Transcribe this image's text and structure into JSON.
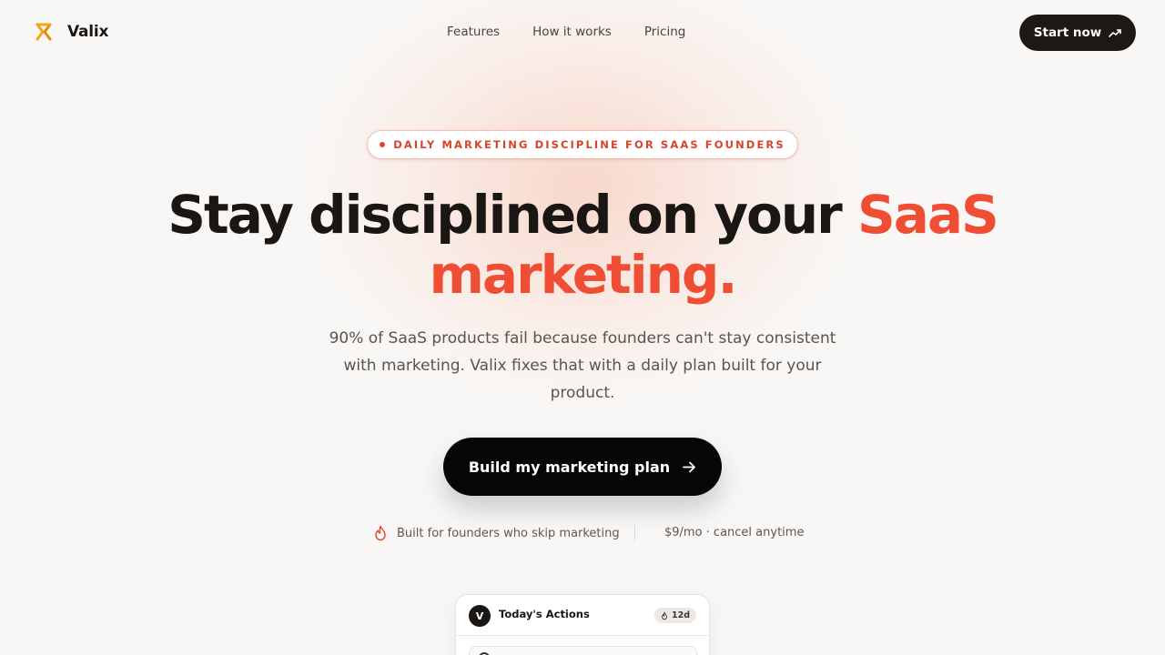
{
  "brand": {
    "name": "Valix",
    "logo_icon": "valix-logo-icon",
    "accent_color": "#f04e34"
  },
  "nav": {
    "links": [
      "Features",
      "How it works",
      "Pricing"
    ],
    "cta_label": "Start now",
    "cta_icon": "trending-up-icon"
  },
  "hero": {
    "badge": "DAILY MARKETING DISCIPLINE FOR SAAS FOUNDERS",
    "headline_part1": "Stay disciplined on your ",
    "headline_accent1": "SaaS",
    "headline_accent2": "marketing.",
    "subtext": "90% of SaaS products fail because founders can't stay consistent with marketing. Valix fixes that with a daily plan built for your product.",
    "cta_label": "Build my marketing plan",
    "cta_icon": "arrow-right-icon",
    "meta_left": "Built for founders who skip marketing",
    "meta_left_icon": "flame-icon",
    "meta_right": "$9/mo · cancel anytime"
  },
  "preview_card": {
    "avatar": "V",
    "title": "Today's Actions",
    "streak": "12d",
    "streak_icon": "flame-icon"
  }
}
